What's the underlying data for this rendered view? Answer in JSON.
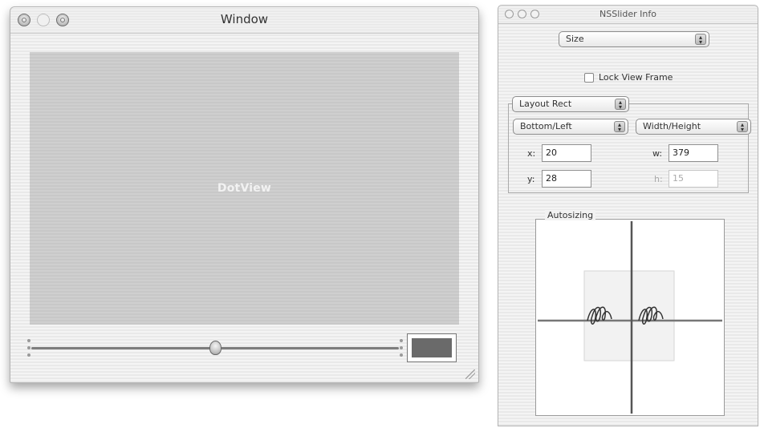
{
  "main_window": {
    "title": "Window",
    "content_label": "DotView",
    "slider": {
      "value": 0.5
    },
    "color_well": {
      "color": "#6a6a6a"
    }
  },
  "info_panel": {
    "title": "NSSlider Info",
    "pane_selector": "Size",
    "lock_view_frame": {
      "label": "Lock View Frame",
      "checked": false
    },
    "layout_selector": "Layout Rect",
    "origin_selector": "Bottom/Left",
    "size_selector": "Width/Height",
    "fields": {
      "x_label": "x:",
      "x_value": "20",
      "y_label": "y:",
      "y_value": "28",
      "w_label": "w:",
      "w_value": "379",
      "h_label": "h:",
      "h_value": "15"
    },
    "autosizing_label": "Autosizing"
  }
}
